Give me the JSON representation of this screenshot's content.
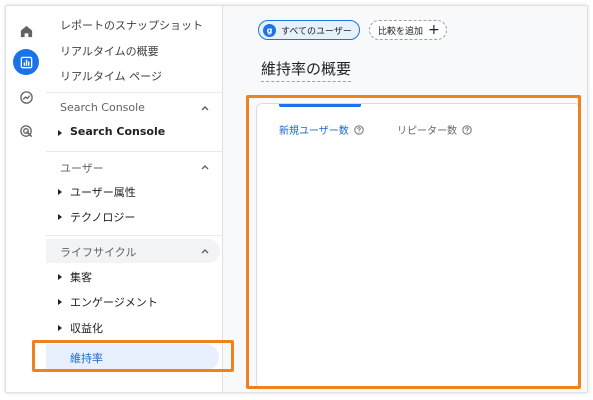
{
  "colors": {
    "accent": "#1a73e8",
    "highlight_border": "#f0821e",
    "selected_bg": "#e8f0fe"
  },
  "rail": {
    "icons": [
      "home-icon",
      "reports-icon",
      "explore-icon",
      "advertising-icon"
    ],
    "active": "reports-icon"
  },
  "sidebar": {
    "top_links": [
      "レポートのスナップショット",
      "リアルタイムの概要",
      "リアルタイム ページ"
    ],
    "sections": [
      {
        "title": "Search Console",
        "items": [
          "Search Console"
        ]
      },
      {
        "title": "ユーザー",
        "items": [
          "ユーザー属性",
          "テクノロジー"
        ]
      },
      {
        "title": "ライフサイクル",
        "items": [
          "集客",
          "エンゲージメント",
          "収益化"
        ]
      }
    ],
    "selected_item": "維持率"
  },
  "topbar": {
    "segment_chip": {
      "avatar_letter": "g",
      "label": "すべてのユーザー"
    },
    "add_comparison": "比較を追加"
  },
  "main": {
    "page_title": "維持率の概要",
    "card": {
      "tabs": [
        {
          "label": "新規ユーザー数",
          "active": true
        },
        {
          "label": "リピーター数",
          "active": false
        }
      ]
    }
  }
}
